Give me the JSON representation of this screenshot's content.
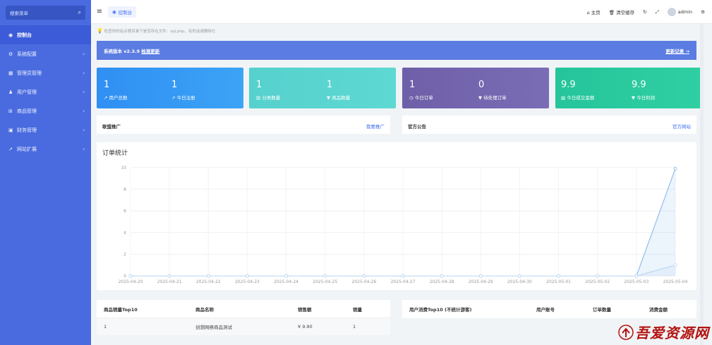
{
  "sidebar": {
    "search_placeholder": "搜索菜单",
    "items": [
      {
        "label": "控制台",
        "icon": "dashboard-icon",
        "glyph": "◉",
        "active": true
      },
      {
        "label": "系统配置",
        "icon": "settings-icon",
        "glyph": "⚙"
      },
      {
        "label": "管理员管理",
        "icon": "admin-icon",
        "glyph": "▦"
      },
      {
        "label": "用户管理",
        "icon": "user-icon",
        "glyph": "♟"
      },
      {
        "label": "商品管理",
        "icon": "cart-icon",
        "glyph": "⊞"
      },
      {
        "label": "财务管理",
        "icon": "finance-icon",
        "glyph": "▣"
      },
      {
        "label": "网站扩展",
        "icon": "external-icon",
        "glyph": "↗"
      }
    ]
  },
  "topbar": {
    "tab_label": "控制台",
    "home": "主页",
    "clear_cache": "清空缓存",
    "username": "admin"
  },
  "notice": "检查你的站点根目录下是否存在文件：sql.php，有的话请删除它",
  "banner": {
    "version_text": "系统版本 v2.3.9",
    "update_link": "检测更新",
    "history_link": "更新记录 →"
  },
  "stats": [
    {
      "a_value": "1",
      "a_label": "用户总数",
      "b_value": "1",
      "b_label": "今日注册"
    },
    {
      "a_value": "1",
      "a_label": "分类数量",
      "b_value": "1",
      "b_label": "商品数量"
    },
    {
      "a_value": "1",
      "a_label": "今日订单",
      "b_value": "0",
      "b_label": "待处理订单"
    },
    {
      "a_value": "9.9",
      "a_label": "今日成交金额",
      "b_value": "9.9",
      "b_label": "今日利润"
    }
  ],
  "panels": {
    "promo_title": "联盟推广",
    "promo_link": "我要推广",
    "announce_title": "官方公告",
    "announce_link": "官方网站"
  },
  "chart_data": {
    "type": "line",
    "title": "订单统计",
    "x": [
      "2025-04-20",
      "2025-04-21",
      "2025-04-22",
      "2025-04-23",
      "2025-04-24",
      "2025-04-25",
      "2025-04-26",
      "2025-04-27",
      "2025-04-28",
      "2025-04-29",
      "2025-04-30",
      "2025-05-01",
      "2025-05-02",
      "2025-05-03",
      "2025-05-04"
    ],
    "series": [
      {
        "values": [
          0,
          0,
          0,
          0,
          0,
          0,
          0,
          0,
          0,
          0,
          0,
          0,
          0,
          0,
          9.9
        ],
        "color": "#7fb4e8"
      },
      {
        "values": [
          0,
          0,
          0,
          0,
          0,
          0,
          0,
          0,
          0,
          0,
          0,
          0,
          0,
          0,
          1
        ],
        "color": "#b7d3f0"
      }
    ],
    "ylim": [
      0,
      10
    ],
    "yticks": [
      0,
      2,
      4,
      6,
      8,
      10
    ],
    "grid": true
  },
  "top_products": {
    "headers": [
      "商品销量Top10",
      "商品名称",
      "销售额",
      "销量"
    ],
    "rows": [
      [
        "1",
        "创想网络商品测试",
        "¥ 9.90",
        "1"
      ]
    ]
  },
  "top_users": {
    "headers": [
      "用户消费Top10 (不统计游客)",
      "用户账号",
      "订单数量",
      "消费金额"
    ]
  },
  "watermark": "吾爱资源网"
}
